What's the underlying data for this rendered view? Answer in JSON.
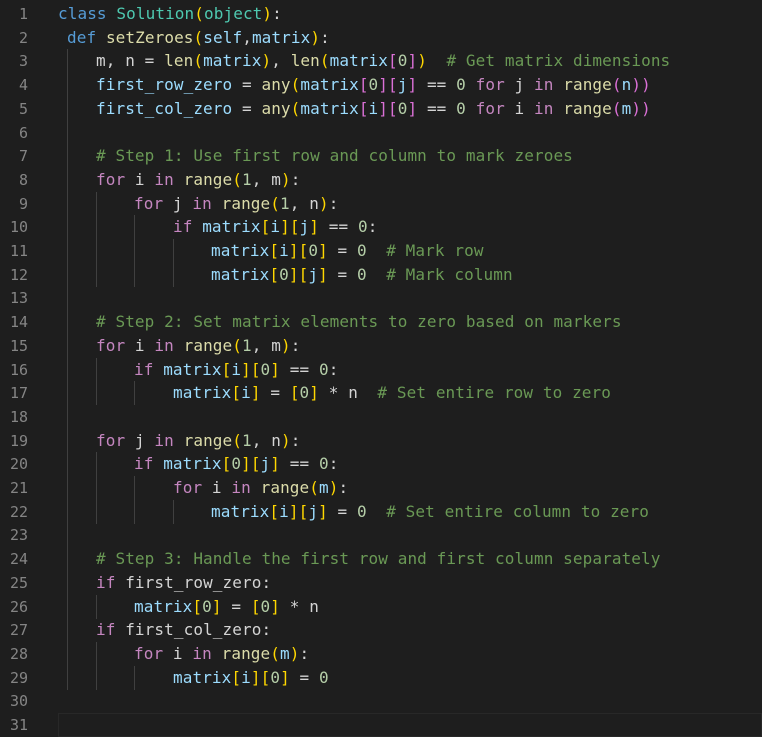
{
  "editor": {
    "colors": {
      "background": "#1e1e1e",
      "line_number": "#858585",
      "keyword": "#569cd6",
      "control": "#c586c0",
      "class": "#4ec9b0",
      "function": "#dcdcaa",
      "variable": "#9cdcfe",
      "number": "#b5cea8",
      "comment": "#6a9955"
    },
    "lines": [
      {
        "n": "1",
        "indent": 0,
        "tokens": [
          [
            "kw",
            "class "
          ],
          [
            "cls",
            "Solution"
          ],
          [
            "p1",
            "("
          ],
          [
            "cls",
            "object"
          ],
          [
            "p1",
            ")"
          ],
          [
            "txt",
            ":"
          ]
        ]
      },
      {
        "n": "2",
        "indent": 1,
        "tokens": [
          [
            "kw",
            "def "
          ],
          [
            "fn",
            "setZeroes"
          ],
          [
            "p1",
            "("
          ],
          [
            "var",
            "self"
          ],
          [
            "txt",
            ","
          ],
          [
            "var",
            "matrix"
          ],
          [
            "p1",
            ")"
          ],
          [
            "txt",
            ":"
          ]
        ]
      },
      {
        "n": "3",
        "indent": 2,
        "tokens": [
          [
            "txt",
            "m, n = "
          ],
          [
            "fn",
            "len"
          ],
          [
            "p1",
            "("
          ],
          [
            "var",
            "matrix"
          ],
          [
            "p1",
            ")"
          ],
          [
            "txt",
            ", "
          ],
          [
            "fn",
            "len"
          ],
          [
            "p1",
            "("
          ],
          [
            "var",
            "matrix"
          ],
          [
            "p2",
            "["
          ],
          [
            "num",
            "0"
          ],
          [
            "p2",
            "]"
          ],
          [
            "p1",
            ")"
          ],
          [
            "txt",
            "  "
          ],
          [
            "cmt",
            "# Get matrix dimensions"
          ]
        ]
      },
      {
        "n": "4",
        "indent": 2,
        "tokens": [
          [
            "var",
            "first_row_zero"
          ],
          [
            "txt",
            " = "
          ],
          [
            "fn",
            "any"
          ],
          [
            "p1",
            "("
          ],
          [
            "var",
            "matrix"
          ],
          [
            "p2",
            "["
          ],
          [
            "num",
            "0"
          ],
          [
            "p2",
            "]"
          ],
          [
            "p2",
            "["
          ],
          [
            "var",
            "j"
          ],
          [
            "p2",
            "]"
          ],
          [
            "txt",
            " == "
          ],
          [
            "num",
            "0"
          ],
          [
            "txt",
            " "
          ],
          [
            "ctl",
            "for"
          ],
          [
            "txt",
            " j "
          ],
          [
            "ctl",
            "in"
          ],
          [
            "txt",
            " "
          ],
          [
            "fn",
            "range"
          ],
          [
            "p2",
            "("
          ],
          [
            "var",
            "n"
          ],
          [
            "p2",
            "))"
          ]
        ]
      },
      {
        "n": "5",
        "indent": 2,
        "tokens": [
          [
            "var",
            "first_col_zero"
          ],
          [
            "txt",
            " = "
          ],
          [
            "fn",
            "any"
          ],
          [
            "p1",
            "("
          ],
          [
            "var",
            "matrix"
          ],
          [
            "p2",
            "["
          ],
          [
            "var",
            "i"
          ],
          [
            "p2",
            "]"
          ],
          [
            "p2",
            "["
          ],
          [
            "num",
            "0"
          ],
          [
            "p2",
            "]"
          ],
          [
            "txt",
            " == "
          ],
          [
            "num",
            "0"
          ],
          [
            "txt",
            " "
          ],
          [
            "ctl",
            "for"
          ],
          [
            "txt",
            " i "
          ],
          [
            "ctl",
            "in"
          ],
          [
            "txt",
            " "
          ],
          [
            "fn",
            "range"
          ],
          [
            "p2",
            "("
          ],
          [
            "var",
            "m"
          ],
          [
            "p2",
            "))"
          ]
        ]
      },
      {
        "n": "6",
        "indent": 2,
        "tokens": []
      },
      {
        "n": "7",
        "indent": 2,
        "tokens": [
          [
            "cmt",
            "# Step 1: Use first row and column to mark zeroes"
          ]
        ]
      },
      {
        "n": "8",
        "indent": 2,
        "tokens": [
          [
            "ctl",
            "for"
          ],
          [
            "txt",
            " i "
          ],
          [
            "ctl",
            "in"
          ],
          [
            "txt",
            " "
          ],
          [
            "fn",
            "range"
          ],
          [
            "p1",
            "("
          ],
          [
            "num",
            "1"
          ],
          [
            "txt",
            ", m"
          ],
          [
            "p1",
            ")"
          ],
          [
            "txt",
            ":"
          ]
        ]
      },
      {
        "n": "9",
        "indent": 3,
        "tokens": [
          [
            "ctl",
            "for"
          ],
          [
            "txt",
            " j "
          ],
          [
            "ctl",
            "in"
          ],
          [
            "txt",
            " "
          ],
          [
            "fn",
            "range"
          ],
          [
            "p1",
            "("
          ],
          [
            "num",
            "1"
          ],
          [
            "txt",
            ", n"
          ],
          [
            "p1",
            ")"
          ],
          [
            "txt",
            ":"
          ]
        ]
      },
      {
        "n": "10",
        "indent": 4,
        "tokens": [
          [
            "ctl",
            "if"
          ],
          [
            "txt",
            " "
          ],
          [
            "var",
            "matrix"
          ],
          [
            "p1",
            "["
          ],
          [
            "var",
            "i"
          ],
          [
            "p1",
            "]"
          ],
          [
            "p1",
            "["
          ],
          [
            "var",
            "j"
          ],
          [
            "p1",
            "]"
          ],
          [
            "txt",
            " == "
          ],
          [
            "num",
            "0"
          ],
          [
            "txt",
            ":"
          ]
        ]
      },
      {
        "n": "11",
        "indent": 5,
        "tokens": [
          [
            "var",
            "matrix"
          ],
          [
            "p1",
            "["
          ],
          [
            "var",
            "i"
          ],
          [
            "p1",
            "]"
          ],
          [
            "p1",
            "["
          ],
          [
            "num",
            "0"
          ],
          [
            "p1",
            "]"
          ],
          [
            "txt",
            " = "
          ],
          [
            "num",
            "0"
          ],
          [
            "txt",
            "  "
          ],
          [
            "cmt",
            "# Mark row"
          ]
        ]
      },
      {
        "n": "12",
        "indent": 5,
        "tokens": [
          [
            "var",
            "matrix"
          ],
          [
            "p1",
            "["
          ],
          [
            "num",
            "0"
          ],
          [
            "p1",
            "]"
          ],
          [
            "p1",
            "["
          ],
          [
            "var",
            "j"
          ],
          [
            "p1",
            "]"
          ],
          [
            "txt",
            " = "
          ],
          [
            "num",
            "0"
          ],
          [
            "txt",
            "  "
          ],
          [
            "cmt",
            "# Mark column"
          ]
        ]
      },
      {
        "n": "13",
        "indent": 2,
        "tokens": []
      },
      {
        "n": "14",
        "indent": 2,
        "tokens": [
          [
            "cmt",
            "# Step 2: Set matrix elements to zero based on markers"
          ]
        ]
      },
      {
        "n": "15",
        "indent": 2,
        "tokens": [
          [
            "ctl",
            "for"
          ],
          [
            "txt",
            " i "
          ],
          [
            "ctl",
            "in"
          ],
          [
            "txt",
            " "
          ],
          [
            "fn",
            "range"
          ],
          [
            "p1",
            "("
          ],
          [
            "num",
            "1"
          ],
          [
            "txt",
            ", m"
          ],
          [
            "p1",
            ")"
          ],
          [
            "txt",
            ":"
          ]
        ]
      },
      {
        "n": "16",
        "indent": 3,
        "tokens": [
          [
            "ctl",
            "if"
          ],
          [
            "txt",
            " "
          ],
          [
            "var",
            "matrix"
          ],
          [
            "p1",
            "["
          ],
          [
            "var",
            "i"
          ],
          [
            "p1",
            "]"
          ],
          [
            "p1",
            "["
          ],
          [
            "num",
            "0"
          ],
          [
            "p1",
            "]"
          ],
          [
            "txt",
            " == "
          ],
          [
            "num",
            "0"
          ],
          [
            "txt",
            ":"
          ]
        ]
      },
      {
        "n": "17",
        "indent": 4,
        "tokens": [
          [
            "var",
            "matrix"
          ],
          [
            "p1",
            "["
          ],
          [
            "var",
            "i"
          ],
          [
            "p1",
            "]"
          ],
          [
            "txt",
            " = "
          ],
          [
            "p1",
            "["
          ],
          [
            "num",
            "0"
          ],
          [
            "p1",
            "]"
          ],
          [
            "txt",
            " * n  "
          ],
          [
            "cmt",
            "# Set entire row to zero"
          ]
        ]
      },
      {
        "n": "18",
        "indent": 2,
        "tokens": []
      },
      {
        "n": "19",
        "indent": 2,
        "tokens": [
          [
            "ctl",
            "for"
          ],
          [
            "txt",
            " j "
          ],
          [
            "ctl",
            "in"
          ],
          [
            "txt",
            " "
          ],
          [
            "fn",
            "range"
          ],
          [
            "p1",
            "("
          ],
          [
            "num",
            "1"
          ],
          [
            "txt",
            ", n"
          ],
          [
            "p1",
            ")"
          ],
          [
            "txt",
            ":"
          ]
        ]
      },
      {
        "n": "20",
        "indent": 3,
        "tokens": [
          [
            "ctl",
            "if"
          ],
          [
            "txt",
            " "
          ],
          [
            "var",
            "matrix"
          ],
          [
            "p1",
            "["
          ],
          [
            "num",
            "0"
          ],
          [
            "p1",
            "]"
          ],
          [
            "p1",
            "["
          ],
          [
            "var",
            "j"
          ],
          [
            "p1",
            "]"
          ],
          [
            "txt",
            " == "
          ],
          [
            "num",
            "0"
          ],
          [
            "txt",
            ":"
          ]
        ]
      },
      {
        "n": "21",
        "indent": 4,
        "tokens": [
          [
            "ctl",
            "for"
          ],
          [
            "txt",
            " i "
          ],
          [
            "ctl",
            "in"
          ],
          [
            "txt",
            " "
          ],
          [
            "fn",
            "range"
          ],
          [
            "p1",
            "("
          ],
          [
            "var",
            "m"
          ],
          [
            "p1",
            ")"
          ],
          [
            "txt",
            ":"
          ]
        ]
      },
      {
        "n": "22",
        "indent": 5,
        "tokens": [
          [
            "var",
            "matrix"
          ],
          [
            "p1",
            "["
          ],
          [
            "var",
            "i"
          ],
          [
            "p1",
            "]"
          ],
          [
            "p1",
            "["
          ],
          [
            "var",
            "j"
          ],
          [
            "p1",
            "]"
          ],
          [
            "txt",
            " = "
          ],
          [
            "num",
            "0"
          ],
          [
            "txt",
            "  "
          ],
          [
            "cmt",
            "# Set entire column to zero"
          ]
        ]
      },
      {
        "n": "23",
        "indent": 2,
        "tokens": []
      },
      {
        "n": "24",
        "indent": 2,
        "tokens": [
          [
            "cmt",
            "# Step 3: Handle the first row and first column separately"
          ]
        ]
      },
      {
        "n": "25",
        "indent": 2,
        "tokens": [
          [
            "ctl",
            "if"
          ],
          [
            "txt",
            " first_row_zero:"
          ]
        ]
      },
      {
        "n": "26",
        "indent": 3,
        "tokens": [
          [
            "var",
            "matrix"
          ],
          [
            "p1",
            "["
          ],
          [
            "num",
            "0"
          ],
          [
            "p1",
            "]"
          ],
          [
            "txt",
            " = "
          ],
          [
            "p1",
            "["
          ],
          [
            "num",
            "0"
          ],
          [
            "p1",
            "]"
          ],
          [
            "txt",
            " * n"
          ]
        ]
      },
      {
        "n": "27",
        "indent": 2,
        "tokens": [
          [
            "ctl",
            "if"
          ],
          [
            "txt",
            " first_col_zero:"
          ]
        ]
      },
      {
        "n": "28",
        "indent": 3,
        "tokens": [
          [
            "ctl",
            "for"
          ],
          [
            "txt",
            " i "
          ],
          [
            "ctl",
            "in"
          ],
          [
            "txt",
            " "
          ],
          [
            "fn",
            "range"
          ],
          [
            "p1",
            "("
          ],
          [
            "var",
            "m"
          ],
          [
            "p1",
            ")"
          ],
          [
            "txt",
            ":"
          ]
        ]
      },
      {
        "n": "29",
        "indent": 4,
        "tokens": [
          [
            "var",
            "matrix"
          ],
          [
            "p1",
            "["
          ],
          [
            "var",
            "i"
          ],
          [
            "p1",
            "]"
          ],
          [
            "p1",
            "["
          ],
          [
            "num",
            "0"
          ],
          [
            "p1",
            "]"
          ],
          [
            "txt",
            " = "
          ],
          [
            "num",
            "0"
          ]
        ]
      },
      {
        "n": "30",
        "indent": 1,
        "tokens": []
      },
      {
        "n": "31",
        "indent": 0,
        "tokens": [],
        "current": true
      }
    ]
  }
}
